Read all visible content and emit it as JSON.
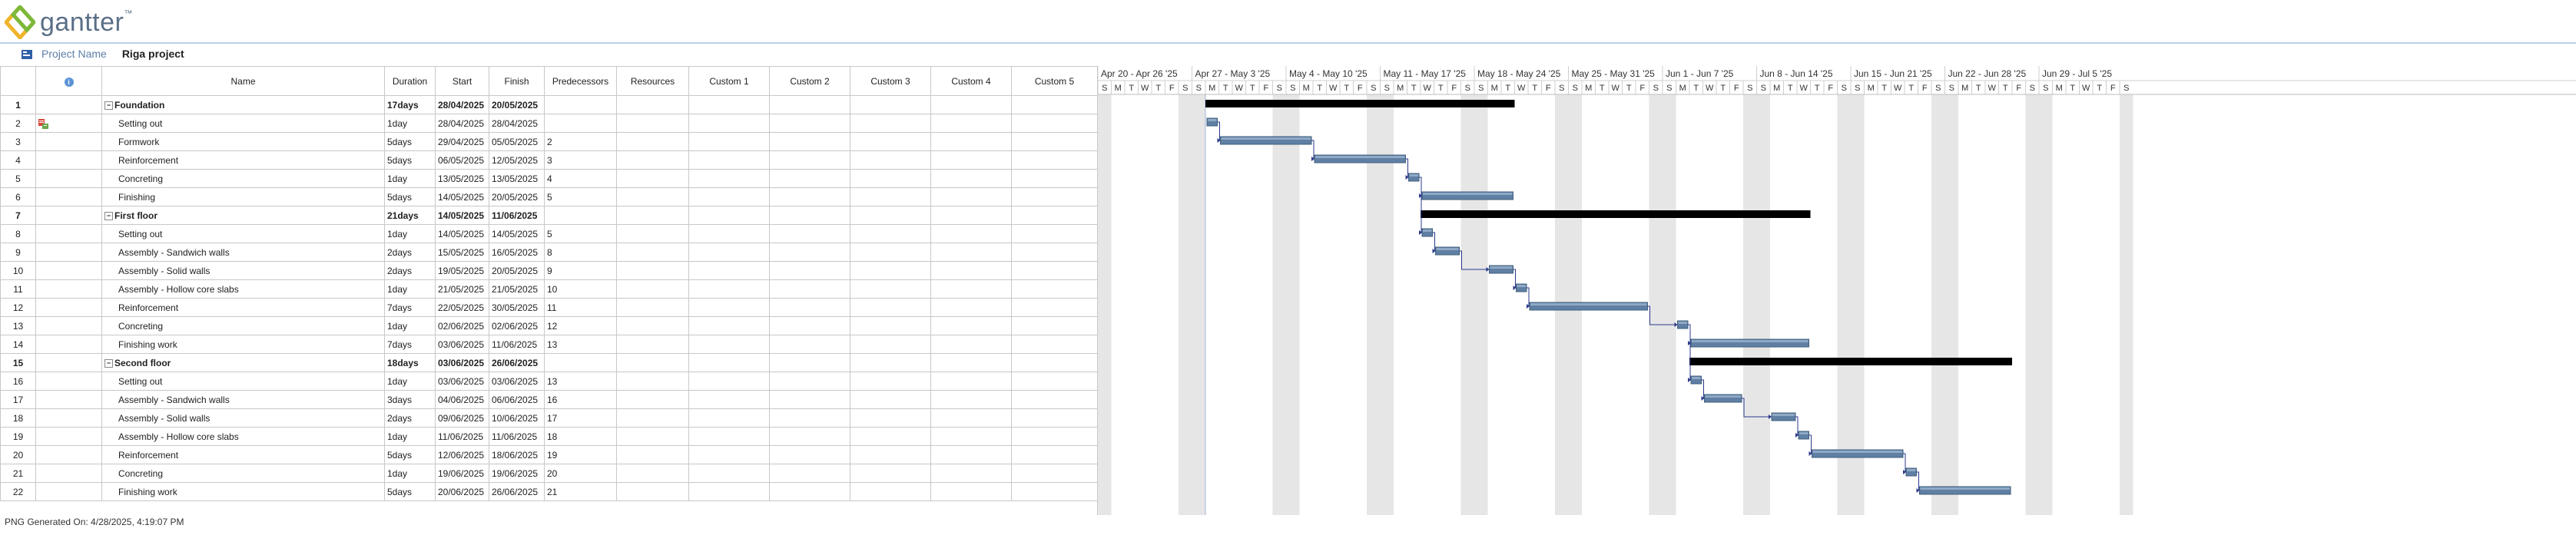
{
  "brand": {
    "name": "gantter",
    "trademark": "™"
  },
  "project": {
    "label": "Project Name",
    "name": "Riga project"
  },
  "columns": [
    "",
    "",
    "Name",
    "Duration",
    "Start",
    "Finish",
    "Predecessors",
    "Resources",
    "Custom 1",
    "Custom 2",
    "Custom 3",
    "Custom 4",
    "Custom 5"
  ],
  "info_icon_label": "i",
  "tasks": [
    {
      "id": "1",
      "name": "Foundation",
      "duration": "17days",
      "start": "28/04/2025",
      "finish": "20/05/2025",
      "pred": "",
      "summary": true,
      "indicator": false
    },
    {
      "id": "2",
      "name": "Setting out",
      "duration": "1day",
      "start": "28/04/2025",
      "finish": "28/04/2025",
      "pred": "",
      "summary": false,
      "indicator": true
    },
    {
      "id": "3",
      "name": "Formwork",
      "duration": "5days",
      "start": "29/04/2025",
      "finish": "05/05/2025",
      "pred": "2",
      "summary": false,
      "indicator": false
    },
    {
      "id": "4",
      "name": "Reinforcement",
      "duration": "5days",
      "start": "06/05/2025",
      "finish": "12/05/2025",
      "pred": "3",
      "summary": false,
      "indicator": false
    },
    {
      "id": "5",
      "name": "Concreting",
      "duration": "1day",
      "start": "13/05/2025",
      "finish": "13/05/2025",
      "pred": "4",
      "summary": false,
      "indicator": false
    },
    {
      "id": "6",
      "name": "Finishing",
      "duration": "5days",
      "start": "14/05/2025",
      "finish": "20/05/2025",
      "pred": "5",
      "summary": false,
      "indicator": false
    },
    {
      "id": "7",
      "name": "First floor",
      "duration": "21days",
      "start": "14/05/2025",
      "finish": "11/06/2025",
      "pred": "",
      "summary": true,
      "indicator": false
    },
    {
      "id": "8",
      "name": "Setting out",
      "duration": "1day",
      "start": "14/05/2025",
      "finish": "14/05/2025",
      "pred": "5",
      "summary": false,
      "indicator": false
    },
    {
      "id": "9",
      "name": "Assembly - Sandwich walls",
      "duration": "2days",
      "start": "15/05/2025",
      "finish": "16/05/2025",
      "pred": "8",
      "summary": false,
      "indicator": false
    },
    {
      "id": "10",
      "name": "Assembly - Solid walls",
      "duration": "2days",
      "start": "19/05/2025",
      "finish": "20/05/2025",
      "pred": "9",
      "summary": false,
      "indicator": false
    },
    {
      "id": "11",
      "name": "Assembly - Hollow core slabs",
      "duration": "1day",
      "start": "21/05/2025",
      "finish": "21/05/2025",
      "pred": "10",
      "summary": false,
      "indicator": false
    },
    {
      "id": "12",
      "name": "Reinforcement",
      "duration": "7days",
      "start": "22/05/2025",
      "finish": "30/05/2025",
      "pred": "11",
      "summary": false,
      "indicator": false
    },
    {
      "id": "13",
      "name": "Concreting",
      "duration": "1day",
      "start": "02/06/2025",
      "finish": "02/06/2025",
      "pred": "12",
      "summary": false,
      "indicator": false
    },
    {
      "id": "14",
      "name": "Finishing work",
      "duration": "7days",
      "start": "03/06/2025",
      "finish": "11/06/2025",
      "pred": "13",
      "summary": false,
      "indicator": false
    },
    {
      "id": "15",
      "name": "Second floor",
      "duration": "18days",
      "start": "03/06/2025",
      "finish": "26/06/2025",
      "pred": "",
      "summary": true,
      "indicator": false
    },
    {
      "id": "16",
      "name": "Setting out",
      "duration": "1day",
      "start": "03/06/2025",
      "finish": "03/06/2025",
      "pred": "13",
      "summary": false,
      "indicator": false
    },
    {
      "id": "17",
      "name": "Assembly - Sandwich walls",
      "duration": "3days",
      "start": "04/06/2025",
      "finish": "06/06/2025",
      "pred": "16",
      "summary": false,
      "indicator": false
    },
    {
      "id": "18",
      "name": "Assembly - Solid walls",
      "duration": "2days",
      "start": "09/06/2025",
      "finish": "10/06/2025",
      "pred": "17",
      "summary": false,
      "indicator": false
    },
    {
      "id": "19",
      "name": "Assembly - Hollow core slabs",
      "duration": "1day",
      "start": "11/06/2025",
      "finish": "11/06/2025",
      "pred": "18",
      "summary": false,
      "indicator": false
    },
    {
      "id": "20",
      "name": "Reinforcement",
      "duration": "5days",
      "start": "12/06/2025",
      "finish": "18/06/2025",
      "pred": "19",
      "summary": false,
      "indicator": false
    },
    {
      "id": "21",
      "name": "Concreting",
      "duration": "1day",
      "start": "19/06/2025",
      "finish": "19/06/2025",
      "pred": "20",
      "summary": false,
      "indicator": false
    },
    {
      "id": "22",
      "name": "Finishing work",
      "duration": "5days",
      "start": "20/06/2025",
      "finish": "26/06/2025",
      "pred": "21",
      "summary": false,
      "indicator": false
    }
  ],
  "timeline": {
    "weeks": [
      "Apr 20 - Apr 26 '25",
      "Apr 27 - May 3 '25",
      "May 4 - May 10 '25",
      "May 11 - May 17 '25",
      "May 18 - May 24 '25",
      "May 25 - May 31 '25",
      "Jun 1 - Jun 7 '25",
      "Jun 8 - Jun 14 '25",
      "Jun 15 - Jun 21 '25",
      "Jun 22 - Jun 28 '25",
      "Jun 29 - Jul 5 '25"
    ],
    "day_letters": [
      "S",
      "M",
      "T",
      "W",
      "T",
      "F",
      "S"
    ]
  },
  "colors": {
    "bar": "#5f7fa3",
    "bar_light": "#8fa9c6",
    "summary": "#000000",
    "weekend": "#e6e6e6",
    "link": "#2b3a8c"
  },
  "footer": "PNG Generated On: 4/28/2025, 4:19:07 PM"
}
